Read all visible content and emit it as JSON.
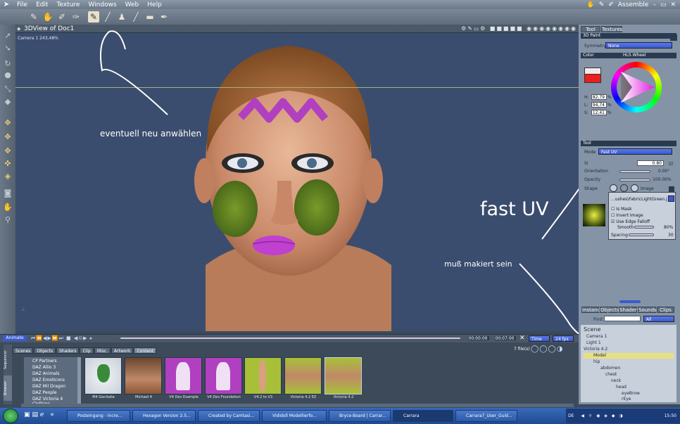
{
  "menu": {
    "items": [
      "File",
      "Edit",
      "Texture",
      "Windows",
      "Web",
      "Help"
    ],
    "room": "Assemble"
  },
  "viewport": {
    "title": "3DView of Doc1",
    "camera": "Camera 1 243,48%"
  },
  "annotations": {
    "a1": "eventuell neu anwählen",
    "a2": "fast UV",
    "a3": "muß makiert sein"
  },
  "rightpanel": {
    "tabs": [
      "Tool",
      "Textures"
    ],
    "sec_3dpaint": "3D Paint",
    "symmetry_label": "Symmetry",
    "symmetry_value": "None",
    "sec_color": "Color",
    "color_mode": "HLS Wheel",
    "h_label": "H:",
    "h_value": "82,79",
    "l_label": "L:",
    "l_value": "94,74",
    "s_label": "S:",
    "s_value": "12,41",
    "pct": "%",
    "sec_tool": "Tool",
    "mode_label": "Mode",
    "mode_value": "Fast UV",
    "size_label": "Si",
    "size_value": "0.80",
    "orientation_label": "Orientation",
    "orientation_value": "0.00°",
    "opacity_label": "Opacity",
    "opacity_value": "100.00%",
    "shape_label": "Shape",
    "image_label": "Image",
    "brush_file": "...ushes\\FabricLightGreen.jpg",
    "is_mask": "Is Mask",
    "invert_image": "Invert Image",
    "use_edge": "Use Edge Falloff",
    "smooth_label": "Smooth",
    "smooth_value": "80%",
    "spacing_label": "Spacing",
    "spacing_value": "30",
    "lower_tabs": [
      "Instance",
      "Objects",
      "Shaders",
      "Sounds",
      "Clips"
    ],
    "find_label": "Find:",
    "find_filter": "All",
    "scene": "Scene",
    "tree": [
      "Camera 1",
      "Light 1",
      "Victoria 4.2",
      "Model",
      "hip",
      "abdomen",
      "chest",
      "neck",
      "head",
      "eyeBrow",
      "rEye"
    ]
  },
  "timeline": {
    "animate": "Animate",
    "t1": "00:00:00",
    "t2": "00:07:00",
    "time": "Time",
    "fps": "24 fps"
  },
  "browser": {
    "tabs": [
      "Scenes",
      "Objects",
      "Shaders",
      "Clip",
      "Misc.",
      "Artwork",
      "Content"
    ],
    "count": "7 file(s)",
    "list": [
      "CP Partners",
      "DAZ Allio 3",
      "DAZ Animals",
      "DAZ Emoticons",
      "DAZ Mil Dragon",
      "DAZ People",
      "DAZ Victoria 4 Clothing"
    ],
    "thumbs": [
      "M4 Genitalia",
      "Michael 4",
      "V4 Dev Example",
      "V4 Dev Foundation",
      "V4.2 to V3",
      "Victoria 4.2 EZ",
      "Victoria 4.2"
    ],
    "side_tabs": [
      "Sequencer",
      "Browser"
    ]
  },
  "taskbar": {
    "tasks": [
      "Posteingang - Incre...",
      "Hexagon Version 2.5...",
      "Created by Camtasi...",
      "Vididoll Modellierfo...",
      "Bryce-Board | Carrar...",
      "Carrara",
      "Carrara7_User_Guid..."
    ],
    "lang": "DE",
    "clock": "15:50"
  }
}
